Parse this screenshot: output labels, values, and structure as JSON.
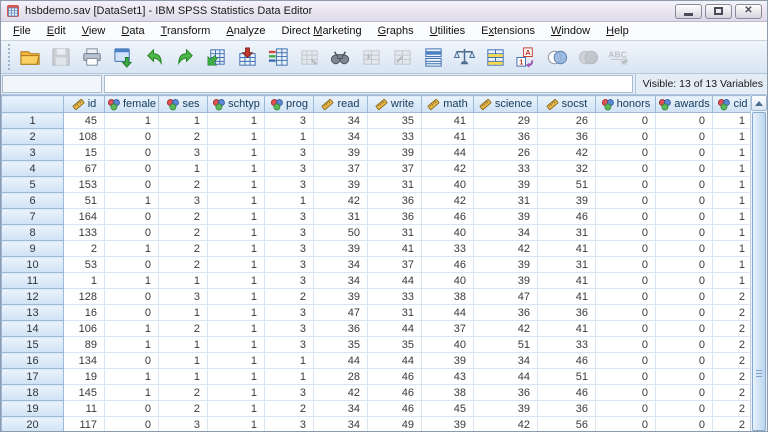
{
  "window": {
    "title": "hsbdemo.sav [DataSet1] - IBM SPSS Statistics Data Editor"
  },
  "menu": {
    "items": [
      {
        "label": "File",
        "key": "F"
      },
      {
        "label": "Edit",
        "key": "E"
      },
      {
        "label": "View",
        "key": "V"
      },
      {
        "label": "Data",
        "key": "D"
      },
      {
        "label": "Transform",
        "key": "T"
      },
      {
        "label": "Analyze",
        "key": "A"
      },
      {
        "label": "Direct Marketing",
        "key": "M"
      },
      {
        "label": "Graphs",
        "key": "G"
      },
      {
        "label": "Utilities",
        "key": "U"
      },
      {
        "label": "Extensions",
        "key": "x"
      },
      {
        "label": "Window",
        "key": "W"
      },
      {
        "label": "Help",
        "key": "H"
      }
    ]
  },
  "toolbar": {
    "buttons": [
      {
        "name": "open-data",
        "enabled": true
      },
      {
        "name": "save",
        "enabled": false
      },
      {
        "name": "print",
        "enabled": true
      },
      {
        "name": "recall-dialogs",
        "enabled": true
      },
      {
        "name": "undo",
        "enabled": true
      },
      {
        "name": "redo",
        "enabled": true
      },
      {
        "name": "goto-case",
        "enabled": true
      },
      {
        "name": "goto-variable",
        "enabled": true
      },
      {
        "name": "variables",
        "enabled": true
      },
      {
        "name": "goto-imputation",
        "enabled": false
      },
      {
        "name": "find",
        "enabled": true
      },
      {
        "name": "insert-cases",
        "enabled": false
      },
      {
        "name": "insert-variable",
        "enabled": false
      },
      {
        "name": "split-file",
        "enabled": true
      },
      {
        "name": "weight-cases",
        "enabled": true
      },
      {
        "name": "select-cases",
        "enabled": true
      },
      {
        "name": "value-labels",
        "enabled": true
      },
      {
        "name": "use-variable-sets",
        "enabled": true
      },
      {
        "name": "show-all-variables",
        "enabled": false
      },
      {
        "name": "spell-check",
        "enabled": false
      }
    ]
  },
  "cellbar": {
    "reference_value": "",
    "editor_value": "",
    "visible_label": "Visible: 13 of 13 Variables"
  },
  "grid": {
    "columns": [
      {
        "label": "id",
        "measure": "scale"
      },
      {
        "label": "female",
        "measure": "nominal"
      },
      {
        "label": "ses",
        "measure": "nominal"
      },
      {
        "label": "schtyp",
        "measure": "nominal"
      },
      {
        "label": "prog",
        "measure": "nominal"
      },
      {
        "label": "read",
        "measure": "scale"
      },
      {
        "label": "write",
        "measure": "scale"
      },
      {
        "label": "math",
        "measure": "scale"
      },
      {
        "label": "science",
        "measure": "scale"
      },
      {
        "label": "socst",
        "measure": "scale"
      },
      {
        "label": "honors",
        "measure": "nominal"
      },
      {
        "label": "awards",
        "measure": "nominal"
      },
      {
        "label": "cid",
        "measure": "nominal"
      }
    ],
    "rows": [
      {
        "n": 1,
        "values": [
          45,
          1,
          1,
          1,
          3,
          34,
          35,
          41,
          29,
          26,
          0,
          0,
          1
        ]
      },
      {
        "n": 2,
        "values": [
          108,
          0,
          2,
          1,
          1,
          34,
          33,
          41,
          36,
          36,
          0,
          0,
          1
        ]
      },
      {
        "n": 3,
        "values": [
          15,
          0,
          3,
          1,
          3,
          39,
          39,
          44,
          26,
          42,
          0,
          0,
          1
        ]
      },
      {
        "n": 4,
        "values": [
          67,
          0,
          1,
          1,
          3,
          37,
          37,
          42,
          33,
          32,
          0,
          0,
          1
        ]
      },
      {
        "n": 5,
        "values": [
          153,
          0,
          2,
          1,
          3,
          39,
          31,
          40,
          39,
          51,
          0,
          0,
          1
        ]
      },
      {
        "n": 6,
        "values": [
          51,
          1,
          3,
          1,
          1,
          42,
          36,
          42,
          31,
          39,
          0,
          0,
          1
        ]
      },
      {
        "n": 7,
        "values": [
          164,
          0,
          2,
          1,
          3,
          31,
          36,
          46,
          39,
          46,
          0,
          0,
          1
        ]
      },
      {
        "n": 8,
        "values": [
          133,
          0,
          2,
          1,
          3,
          50,
          31,
          40,
          34,
          31,
          0,
          0,
          1
        ]
      },
      {
        "n": 9,
        "values": [
          2,
          1,
          2,
          1,
          3,
          39,
          41,
          33,
          42,
          41,
          0,
          0,
          1
        ]
      },
      {
        "n": 10,
        "values": [
          53,
          0,
          2,
          1,
          3,
          34,
          37,
          46,
          39,
          31,
          0,
          0,
          1
        ]
      },
      {
        "n": 11,
        "values": [
          1,
          1,
          1,
          1,
          3,
          34,
          44,
          40,
          39,
          41,
          0,
          0,
          1
        ]
      },
      {
        "n": 12,
        "values": [
          128,
          0,
          3,
          1,
          2,
          39,
          33,
          38,
          47,
          41,
          0,
          0,
          2
        ]
      },
      {
        "n": 13,
        "values": [
          16,
          0,
          1,
          1,
          3,
          47,
          31,
          44,
          36,
          36,
          0,
          0,
          2
        ]
      },
      {
        "n": 14,
        "values": [
          106,
          1,
          2,
          1,
          3,
          36,
          44,
          37,
          42,
          41,
          0,
          0,
          2
        ]
      },
      {
        "n": 15,
        "values": [
          89,
          1,
          1,
          1,
          3,
          35,
          35,
          40,
          51,
          33,
          0,
          0,
          2
        ]
      },
      {
        "n": 16,
        "values": [
          134,
          0,
          1,
          1,
          1,
          44,
          44,
          39,
          34,
          46,
          0,
          0,
          2
        ]
      },
      {
        "n": 17,
        "values": [
          19,
          1,
          1,
          1,
          1,
          28,
          46,
          43,
          44,
          51,
          0,
          0,
          2
        ]
      },
      {
        "n": 18,
        "values": [
          145,
          1,
          2,
          1,
          3,
          42,
          46,
          38,
          36,
          46,
          0,
          0,
          2
        ]
      },
      {
        "n": 19,
        "values": [
          11,
          0,
          2,
          1,
          2,
          34,
          46,
          45,
          39,
          36,
          0,
          0,
          2
        ]
      },
      {
        "n": 20,
        "values": [
          117,
          0,
          3,
          1,
          3,
          34,
          49,
          39,
          42,
          56,
          0,
          0,
          2
        ]
      }
    ]
  }
}
